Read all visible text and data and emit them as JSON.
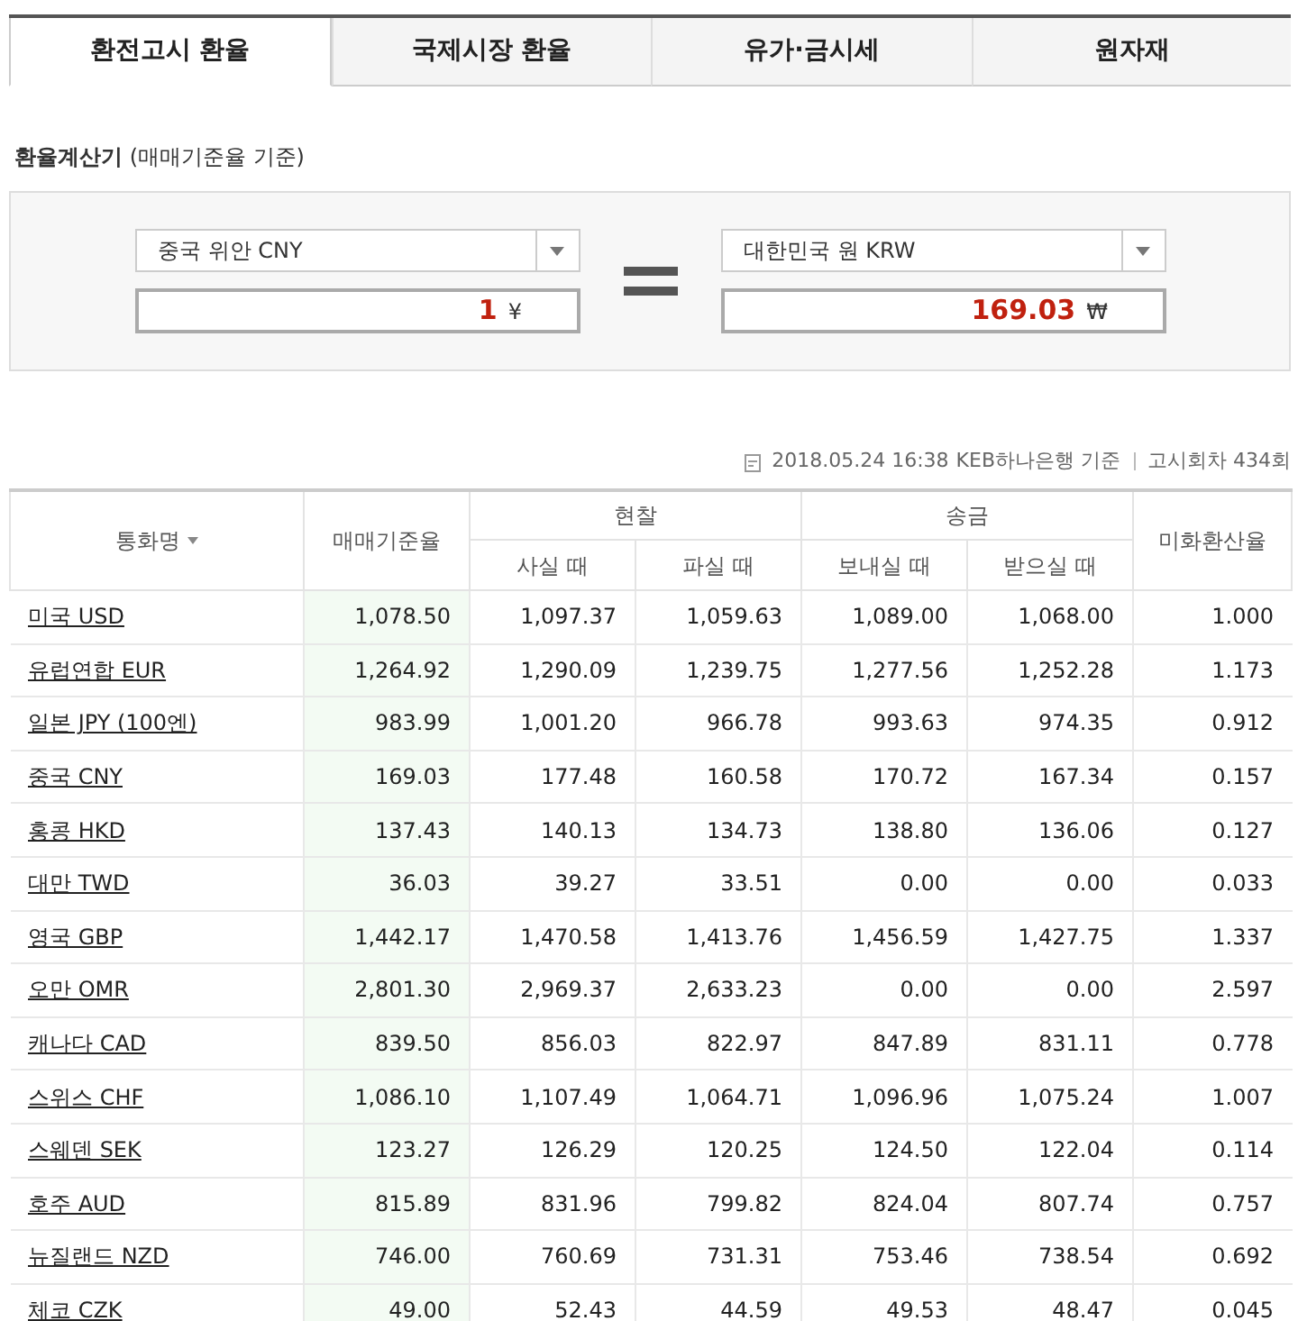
{
  "tabs": [
    {
      "label": "환전고시 환율",
      "selected": true
    },
    {
      "label": "국제시장 환율",
      "selected": false
    },
    {
      "label": "유가·금시세",
      "selected": false
    },
    {
      "label": "원자재",
      "selected": false
    }
  ],
  "calculator": {
    "title": "환율계산기",
    "subtitle": "(매매기준율 기준)",
    "from": {
      "currency": "중국 위안 CNY",
      "amount": "1",
      "symbol": "¥"
    },
    "to": {
      "currency": "대한민국 원 KRW",
      "amount": "169.03",
      "symbol": "₩"
    }
  },
  "info": {
    "date": "2018.05.24 16:38",
    "bank": "KEB하나은행 기준",
    "round": "고시회차 434회"
  },
  "table": {
    "headers": {
      "currency": "통화명",
      "base": "매매기준율",
      "cash": "현찰",
      "cash_buy": "사실 때",
      "cash_sell": "파실 때",
      "transfer": "송금",
      "send": "보내실 때",
      "receive": "받으실 때",
      "usd_rate": "미화환산율"
    },
    "rows": [
      [
        "미국 USD",
        "1,078.50",
        "1,097.37",
        "1,059.63",
        "1,089.00",
        "1,068.00",
        "1.000"
      ],
      [
        "유럽연합 EUR",
        "1,264.92",
        "1,290.09",
        "1,239.75",
        "1,277.56",
        "1,252.28",
        "1.173"
      ],
      [
        "일본 JPY (100엔)",
        "983.99",
        "1,001.20",
        "966.78",
        "993.63",
        "974.35",
        "0.912"
      ],
      [
        "중국 CNY",
        "169.03",
        "177.48",
        "160.58",
        "170.72",
        "167.34",
        "0.157"
      ],
      [
        "홍콩 HKD",
        "137.43",
        "140.13",
        "134.73",
        "138.80",
        "136.06",
        "0.127"
      ],
      [
        "대만 TWD",
        "36.03",
        "39.27",
        "33.51",
        "0.00",
        "0.00",
        "0.033"
      ],
      [
        "영국 GBP",
        "1,442.17",
        "1,470.58",
        "1,413.76",
        "1,456.59",
        "1,427.75",
        "1.337"
      ],
      [
        "오만 OMR",
        "2,801.30",
        "2,969.37",
        "2,633.23",
        "0.00",
        "0.00",
        "2.597"
      ],
      [
        "캐나다 CAD",
        "839.50",
        "856.03",
        "822.97",
        "847.89",
        "831.11",
        "0.778"
      ],
      [
        "스위스 CHF",
        "1,086.10",
        "1,107.49",
        "1,064.71",
        "1,096.96",
        "1,075.24",
        "1.007"
      ],
      [
        "스웨덴 SEK",
        "123.27",
        "126.29",
        "120.25",
        "124.50",
        "122.04",
        "0.114"
      ],
      [
        "호주 AUD",
        "815.89",
        "831.96",
        "799.82",
        "824.04",
        "807.74",
        "0.757"
      ],
      [
        "뉴질랜드 NZD",
        "746.00",
        "760.69",
        "731.31",
        "753.46",
        "738.54",
        "0.692"
      ],
      [
        "체코 CZK",
        "49.00",
        "52.43",
        "44.59",
        "49.53",
        "48.47",
        "0.045"
      ]
    ]
  }
}
